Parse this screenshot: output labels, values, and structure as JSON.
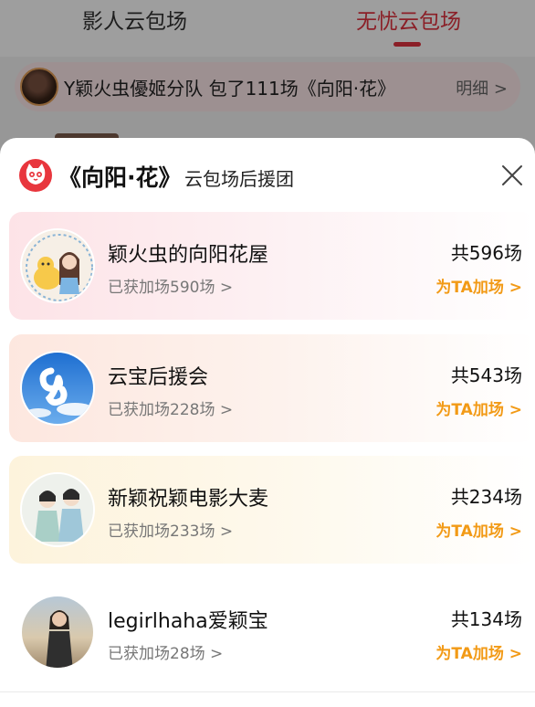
{
  "tabs": [
    {
      "label": "影人云包场",
      "active": false
    },
    {
      "label": "无忧云包场",
      "active": true
    }
  ],
  "banner": {
    "text": "Y颖火虫優姬分队 包了111场《向阳·花》",
    "detail": "明细 >"
  },
  "sheet": {
    "title": "《向阳·花》",
    "subtitle": "云包场后援团",
    "logo_icon": "cat-logo-icon",
    "close_icon": "close-icon",
    "items": [
      {
        "name": "颖火虫的向阳花屋",
        "joined": "已获加场590场 >",
        "total": "共596场",
        "action": "为TA加场 >",
        "avatar_icon": "cartoon-avatar"
      },
      {
        "name": "云宝后援会",
        "joined": "已获加场228场 >",
        "total": "共543场",
        "action": "为TA加场 >",
        "avatar_icon": "cloud-heart-avatar"
      },
      {
        "name": "新颖祝颖电影大麦",
        "joined": "已获加场233场 >",
        "total": "共234场",
        "action": "为TA加场 >",
        "avatar_icon": "illustrated-couple-avatar"
      },
      {
        "name": "legirlhaha爱颖宝",
        "joined": "已获加场28场 >",
        "total": "共134场",
        "action": "为TA加场 >",
        "avatar_icon": "photo-avatar"
      }
    ]
  },
  "colors": {
    "accent": "#e0333f",
    "action": "#f29a16"
  }
}
